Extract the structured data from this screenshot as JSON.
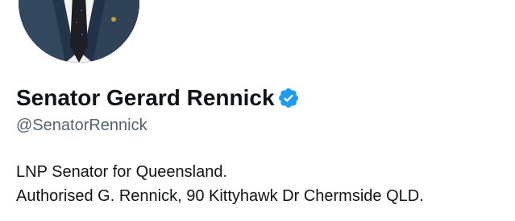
{
  "profile": {
    "display_name": "Senator Gerard Rennick",
    "handle": "@SenatorRennick",
    "verified": true,
    "bio_lines": [
      "LNP Senator for Queensland.",
      "Authorised G. Rennick, 90 Kittyhawk Dr Chermside QLD."
    ],
    "accent_color": "#1d9bf0"
  },
  "icons": {
    "verified": "verified-badge-icon"
  }
}
